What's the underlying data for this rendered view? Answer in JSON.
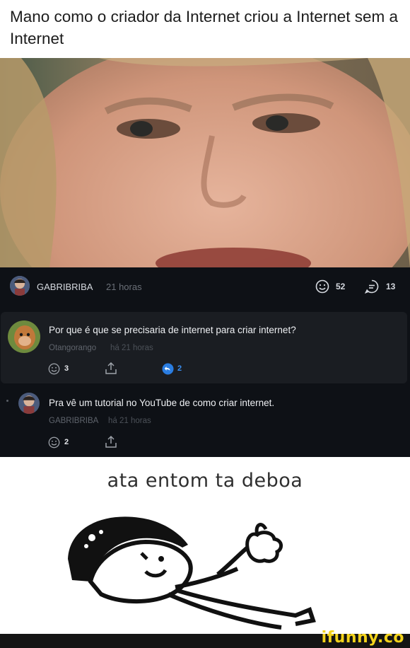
{
  "caption": {
    "text": "Mano como o criador da Internet criou a Internet sem a Internet"
  },
  "post": {
    "username": "GABRIBRIBA",
    "time": "21 horas",
    "smile_count": "52",
    "comment_count": "13"
  },
  "comments": [
    {
      "text": "Por que é que se precisaria de internet para criar internet?",
      "user": "Otangorango",
      "time": "há 21 horas",
      "smile_count": "3",
      "reply_count": "2"
    },
    {
      "text": "Pra vê um tutorial no YouTube de como criar internet.",
      "user": "GABRIBRIBA",
      "time": "há 21 horas",
      "smile_count": "2"
    }
  ],
  "meme": {
    "text": "ata entom ta deboa"
  },
  "watermark": {
    "text": "ifunny.co"
  },
  "colors": {
    "dark_bg": "#0e1116",
    "card_bg": "#1a1d22",
    "reply_blue": "#2a7de1",
    "watermark": "#f2d21b"
  },
  "icons": [
    "smile-icon",
    "comment-icon",
    "share-icon",
    "reply-icon"
  ]
}
